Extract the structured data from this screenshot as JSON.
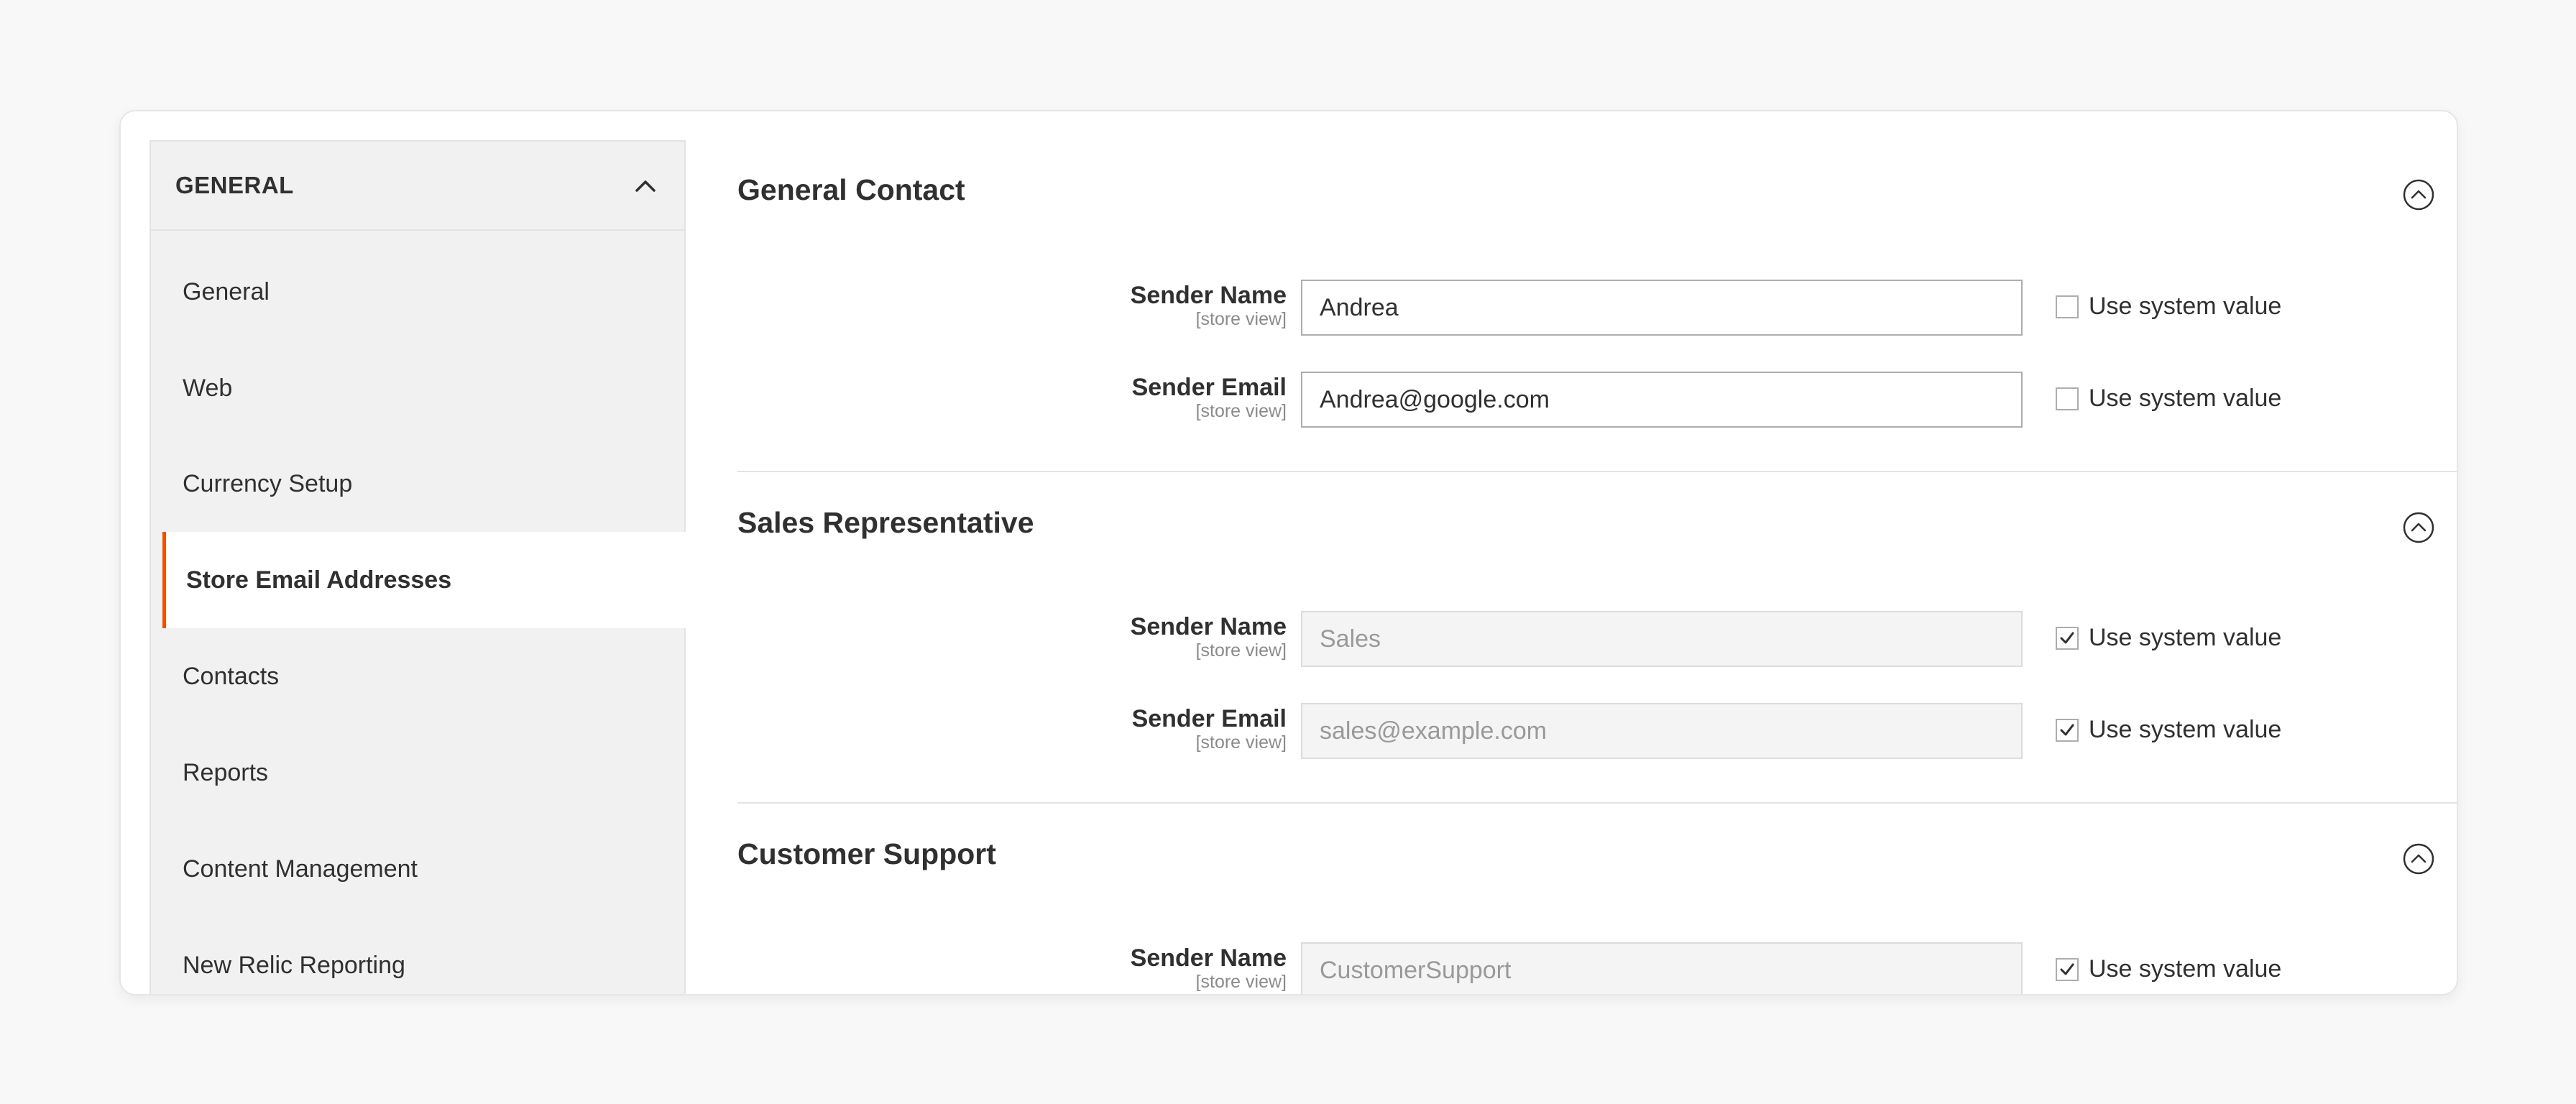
{
  "sidebar": {
    "header": "GENERAL",
    "items": [
      {
        "label": "General",
        "active": false
      },
      {
        "label": "Web",
        "active": false
      },
      {
        "label": "Currency Setup",
        "active": false
      },
      {
        "label": "Store Email Addresses",
        "active": true
      },
      {
        "label": "Contacts",
        "active": false
      },
      {
        "label": "Reports",
        "active": false
      },
      {
        "label": "Content Management",
        "active": false
      },
      {
        "label": "New Relic Reporting",
        "active": false
      }
    ]
  },
  "accent_color": "#eb5202",
  "sections": [
    {
      "title": "General Contact",
      "fields": [
        {
          "label": "Sender Name",
          "scope": "[store view]",
          "value": "Andrea",
          "use_system_value": false,
          "system_label": "Use system value"
        },
        {
          "label": "Sender Email",
          "scope": "[store view]",
          "value": "Andrea@google.com",
          "use_system_value": false,
          "system_label": "Use system value"
        }
      ]
    },
    {
      "title": "Sales Representative",
      "fields": [
        {
          "label": "Sender Name",
          "scope": "[store view]",
          "value": "Sales",
          "use_system_value": true,
          "system_label": "Use system value"
        },
        {
          "label": "Sender Email",
          "scope": "[store view]",
          "value": "sales@example.com",
          "use_system_value": true,
          "system_label": "Use system value"
        }
      ]
    },
    {
      "title": "Customer Support",
      "fields": [
        {
          "label": "Sender Name",
          "scope": "[store view]",
          "value": "CustomerSupport",
          "use_system_value": true,
          "system_label": "Use system value"
        }
      ]
    }
  ]
}
